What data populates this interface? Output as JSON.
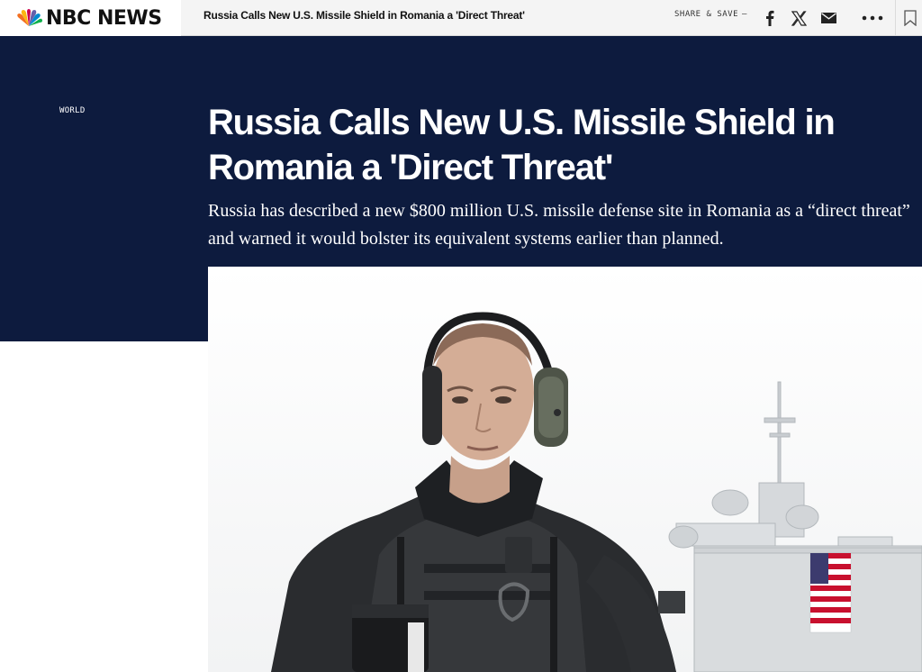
{
  "topbar": {
    "logo_text": "NBC NEWS",
    "headline": "Russia Calls New U.S. Missile Shield in Romania a 'Direct Threat'",
    "share_save_label": "SHARE & SAVE",
    "share_save_suffix": "–",
    "icons": [
      "peacock-logo-icon",
      "facebook-icon",
      "x-icon",
      "mail-icon",
      "more-icon",
      "bookmark-icon"
    ]
  },
  "article": {
    "section": "WORLD",
    "headline": "Russia Calls New U.S. Missile Shield in Romania a 'Direct Threat'",
    "dek": "Russia has described a new $800 million U.S. missile defense site in Romania as a “direct threat” and warned it would bolster its equivalent systems earlier than planned."
  },
  "colors": {
    "navy": "#0d1b3e",
    "topbar_bg": "#f4f4f4",
    "text_dark": "#111111",
    "white": "#ffffff"
  }
}
